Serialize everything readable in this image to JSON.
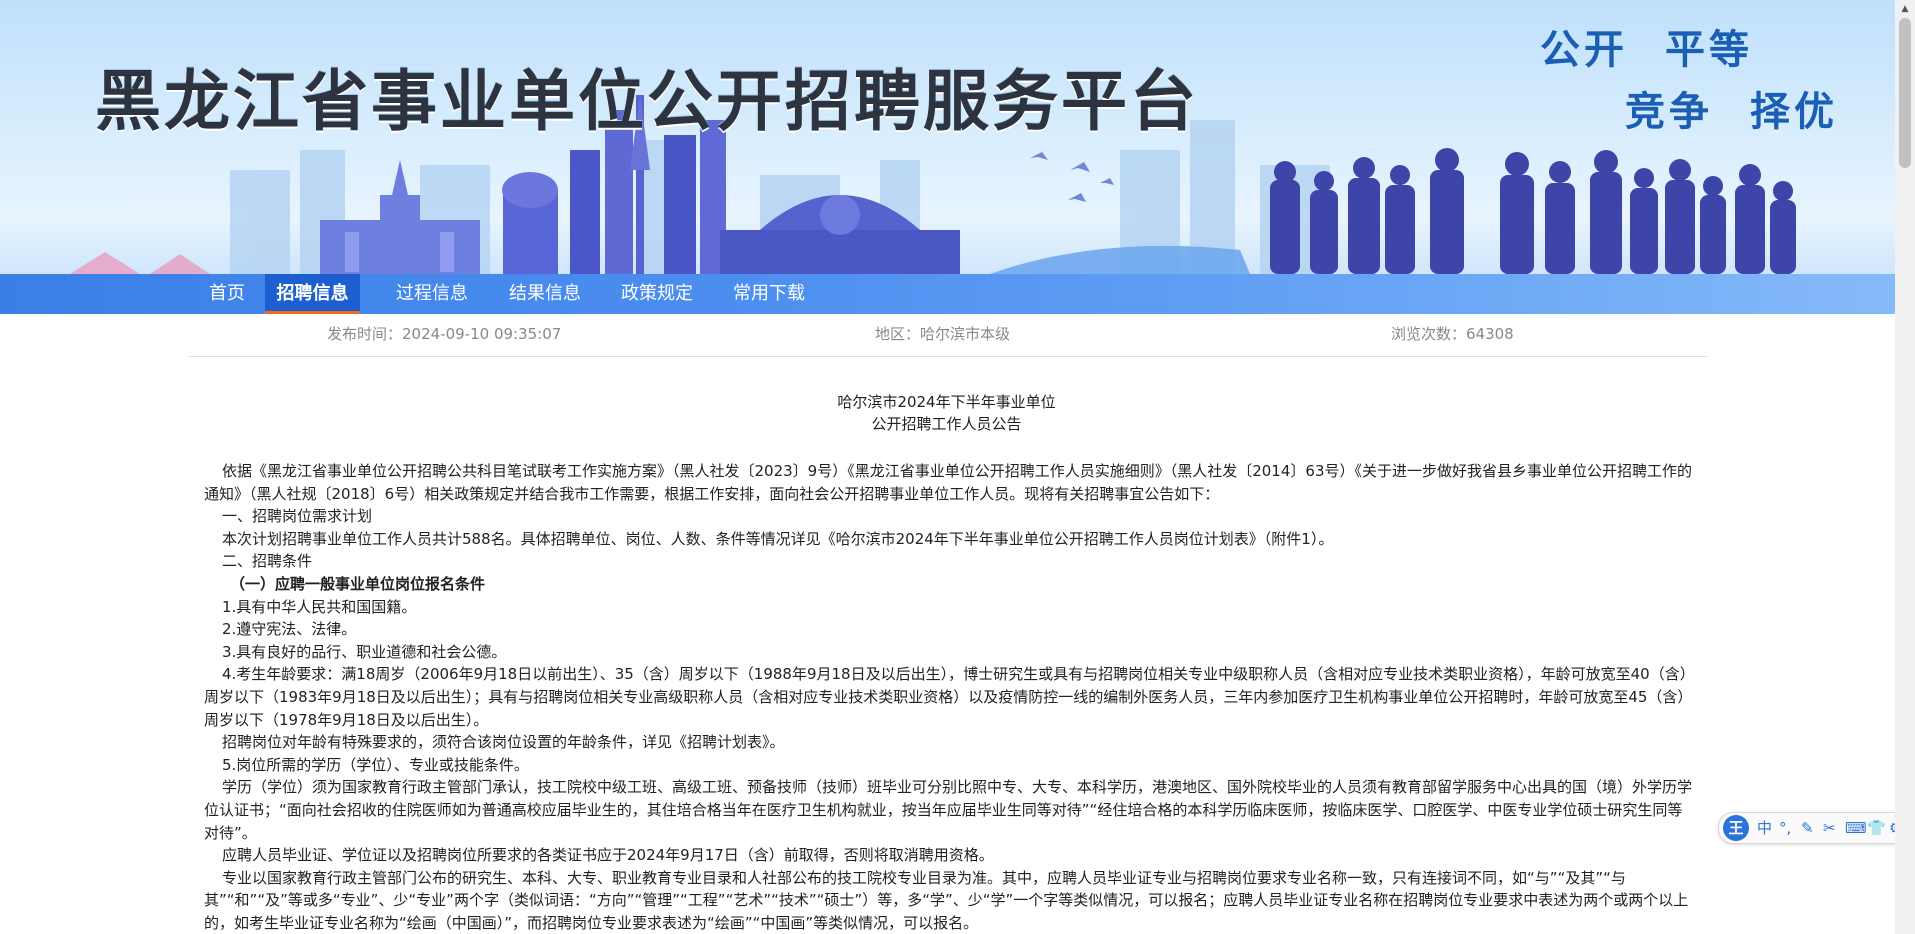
{
  "banner": {
    "site_title": "黑龙江省事业单位公开招聘服务平台",
    "slogans": [
      "公开",
      "平等",
      "竞争",
      "择优"
    ]
  },
  "nav": {
    "items": [
      {
        "label": "首页"
      },
      {
        "label": "招聘信息",
        "active": true
      },
      {
        "label": "过程信息"
      },
      {
        "label": "结果信息"
      },
      {
        "label": "政策规定"
      },
      {
        "label": "常用下载"
      }
    ]
  },
  "meta": {
    "publish_time": "发布时间：2024-09-10 09:35:07",
    "region": "地区：哈尔滨市本级",
    "views": "浏览次数：64308"
  },
  "article": {
    "title_lines": [
      "哈尔滨市2024年下半年事业单位",
      "公开招聘工作人员公告"
    ],
    "paragraphs": [
      "依据《黑龙江省事业单位公开招聘公共科目笔试联考工作实施方案》（黑人社发〔2023〕9号）《黑龙江省事业单位公开招聘工作人员实施细则》（黑人社发〔2014〕63号）《关于进一步做好我省县乡事业单位公开招聘工作的通知》（黑人社规〔2018〕6号）相关政策规定并结合我市工作需要，根据工作安排，面向社会公开招聘事业单位工作人员。现将有关招聘事宜公告如下：",
      "一、招聘岗位需求计划",
      "本次计划招聘事业单位工作人员共计588名。具体招聘单位、岗位、人数、条件等情况详见《哈尔滨市2024年下半年事业单位公开招聘工作人员岗位计划表》（附件1）。",
      "二、招聘条件",
      "（一）应聘一般事业单位岗位报名条件",
      "1.具有中华人民共和国国籍。",
      "2.遵守宪法、法律。",
      "3.具有良好的品行、职业道德和社会公德。",
      "4.考生年龄要求：满18周岁（2006年9月18日以前出生）、35（含）周岁以下（1988年9月18日及以后出生），博士研究生或具有与招聘岗位相关专业中级职称人员（含相对应专业技术类职业资格），年龄可放宽至40（含）周岁以下（1983年9月18日及以后出生）；具有与招聘岗位相关专业高级职称人员（含相对应专业技术类职业资格）以及疫情防控一线的编制外医务人员，三年内参加医疗卫生机构事业单位公开招聘时，年龄可放宽至45（含）周岁以下（1978年9月18日及以后出生）。",
      "招聘岗位对年龄有特殊要求的，须符合该岗位设置的年龄条件，详见《招聘计划表》。",
      "5.岗位所需的学历（学位）、专业或技能条件。",
      "学历（学位）须为国家教育行政主管部门承认，技工院校中级工班、高级工班、预备技师（技师）班毕业可分别比照中专、大专、本科学历，港澳地区、国外院校毕业的人员须有教育部留学服务中心出具的国（境）外学历学位认证书；“面向社会招收的住院医师如为普通高校应届毕业生的，其住培合格当年在医疗卫生机构就业，按当年应届毕业生同等对待”“经住培合格的本科学历临床医师，按临床医学、口腔医学、中医专业学位硕士研究生同等对待”。",
      "应聘人员毕业证、学位证以及招聘岗位所要求的各类证书应于2024年9月17日（含）前取得，否则将取消聘用资格。",
      "专业以国家教育行政主管部门公布的研究生、本科、大专、职业教育专业目录和人社部公布的技工院校专业目录为准。其中，应聘人员毕业证专业与招聘岗位要求专业名称一致，只有连接词不同，如“与”“及其”“与其”“和”“及”等或多“专业”、少“专业”两个字（类似词语：“方向”“管理”“工程”“艺术”“技术”“硕士”）等，多“学”、少“学”一个字等类似情况，可以报名；应聘人员毕业证专业名称在招聘岗位专业要求中表述为两个或两个以上的，如考生毕业证专业名称为“绘画（中国画）”，而招聘岗位专业要求表述为“绘画”“中国画”等类似情况，可以报名。"
    ]
  },
  "ime": {
    "logo": "王",
    "buttons": [
      "中",
      "°,",
      "✎",
      "✂",
      "⌨",
      "👕",
      "⚙"
    ]
  },
  "colors": {
    "nav_bg": "#4d8ff0",
    "nav_active_bg": "#1d5fd0",
    "nav_active_underline": "#f46a1d",
    "slogan": "#1a5fb4",
    "title": "#2d3440"
  }
}
